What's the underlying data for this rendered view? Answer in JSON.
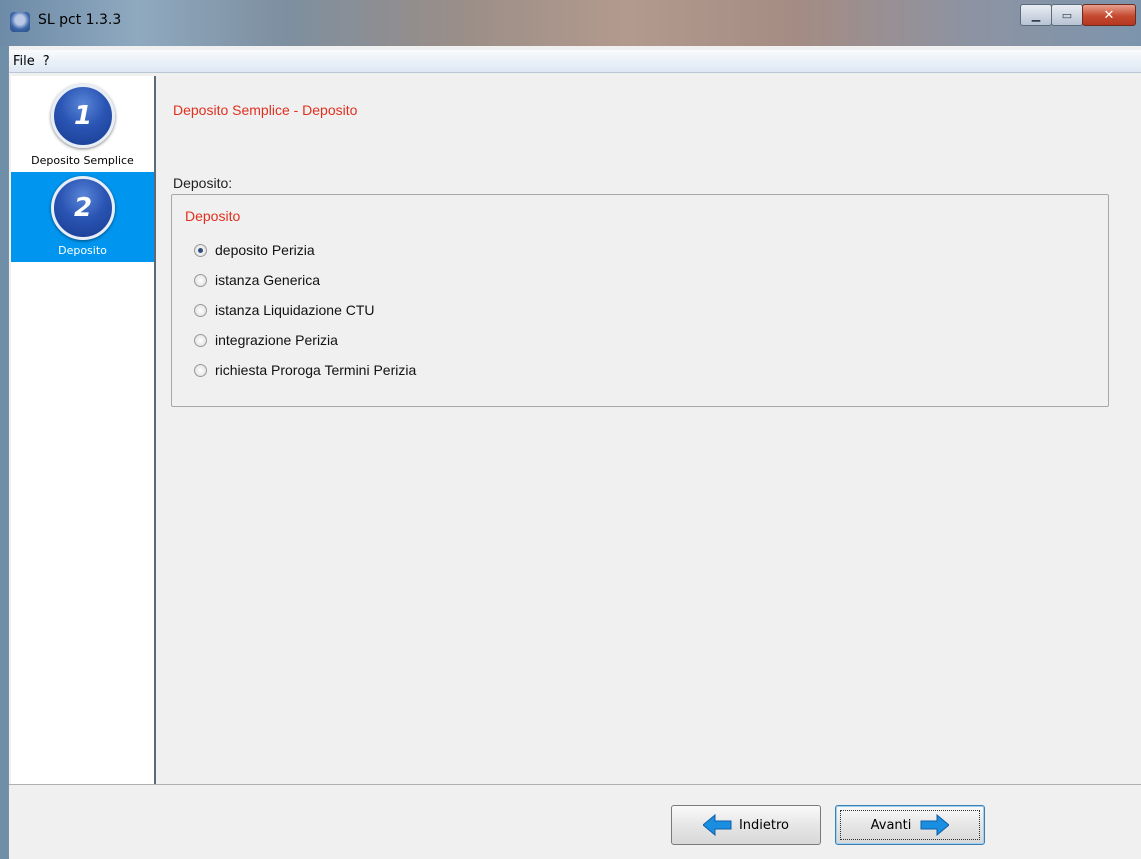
{
  "window": {
    "title": "SL pct 1.3.3",
    "controls": [
      "minimize",
      "maximize",
      "close"
    ]
  },
  "menu": {
    "items": [
      "File",
      "?"
    ]
  },
  "sidebar": {
    "steps": [
      {
        "number": "1",
        "label": "Deposito Semplice",
        "active": false
      },
      {
        "number": "2",
        "label": "Deposito",
        "active": true
      }
    ]
  },
  "main": {
    "page_title": "Deposito Semplice - Deposito",
    "section_label": "Deposito:",
    "group_title": "Deposito",
    "options": [
      {
        "label": "deposito Perizia",
        "checked": true
      },
      {
        "label": "istanza Generica",
        "checked": false
      },
      {
        "label": "istanza Liquidazione CTU",
        "checked": false
      },
      {
        "label": "integrazione Perizia",
        "checked": false
      },
      {
        "label": "richiesta Proroga Termini Perizia",
        "checked": false
      }
    ]
  },
  "footer": {
    "back_label": "Indietro",
    "next_label": "Avanti"
  },
  "colors": {
    "accent_red": "#e03020",
    "active_step": "#0096f0",
    "arrow_blue": "#1a8ee0"
  }
}
